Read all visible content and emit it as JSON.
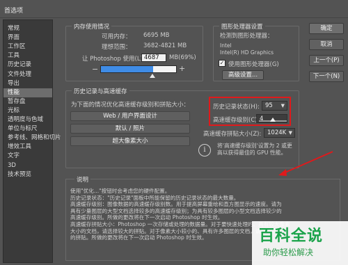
{
  "window": {
    "title": "首选项"
  },
  "sidebar": {
    "items": [
      {
        "label": "常规"
      },
      {
        "label": "界面"
      },
      {
        "label": "工作区"
      },
      {
        "label": "工具"
      },
      {
        "label": "历史记录"
      },
      {
        "label": "文件处理"
      },
      {
        "label": "导出"
      },
      {
        "label": "性能"
      },
      {
        "label": "暂存盘"
      },
      {
        "label": "光标"
      },
      {
        "label": "透明度与色域"
      },
      {
        "label": "单位与标尺"
      },
      {
        "label": "参考线、网格和切片"
      },
      {
        "label": "增效工具"
      },
      {
        "label": "文字"
      },
      {
        "label": "3D"
      },
      {
        "label": "技术预览"
      }
    ],
    "active_index": 7
  },
  "memory": {
    "title": "内存使用情况",
    "available_label": "可用内存：",
    "available_value": "6695 MB",
    "ideal_label": "理想范围：",
    "ideal_value": "3682-4821 MB",
    "let_use_label": "让 Photoshop 使用(L):",
    "let_use_value": "4687",
    "let_use_unit": "MB(69%)",
    "minus": "−",
    "plus": "+",
    "slider_fill_fraction": 0.69
  },
  "gpu": {
    "title": "图形处理器设置",
    "detected_label": "检测到图形处理器：",
    "vendor": "Intel",
    "model": "Intel(R) HD Graphics",
    "use_gpu_label": "使用图形处理器(G)",
    "use_gpu_checked": true,
    "advanced_button": "高级设置..."
  },
  "history_cache": {
    "title": "历史记录与高速缓存",
    "optimize_label": "为下面的情况优化高速缓存级别和拼贴大小：",
    "preset_web": "Web / 用户界面设计",
    "preset_default": "默认 / 照片",
    "preset_huge": "超大像素大小",
    "history_states_label": "历史记录状态(H):",
    "history_states_value": "95",
    "cache_levels_label": "高速缓存级别(C):",
    "cache_levels_value": "4",
    "cache_levels_max": 8,
    "tile_size_label": "高速缓存拼贴大小(Z):",
    "tile_size_value": "1024K",
    "info_icon": "i",
    "info_text_1": "将'高速缓存级别'设置为 2 或更",
    "info_text_2": "高以获得最佳的 GPU 性能。"
  },
  "description": {
    "title": "说明",
    "lines": [
      "使用\"优化...\"按钮时会考虑您的硬件配置。",
      "历史记录状态：\"历史记录\"面板中所能保留的历史记录状态的最大数量。",
      "高速缓存级别：图像数据的高速缓存级别数。用于提高屏幕重绘和直方图显示的速度。请为",
      "具有少量图层的大型文档选择较多的高速缓存级别；为具有较多图层的小型文档选择较少的",
      "高速缓存级别。所做的更改将在下一次启动 Photoshop 时生效。",
      "高速缓存拼贴大小：Photoshop 一次存储或处理的数据量。对于要快速处理的、具有较大像素",
      "大小的文档，请选择较大的拼贴。对于像素大小较小的、具有许多图层的文档，请选择较小",
      "的拼贴。所做的更改将在下一次启动 Photoshop 时生效。"
    ]
  },
  "buttons": {
    "ok": "确定",
    "cancel": "取消",
    "prev": "上一个(P)",
    "next": "下一个(N)"
  },
  "watermark": {
    "title": "百科全说",
    "subtitle": "助你轻松解决"
  },
  "colors": {
    "highlight_red": "#e0191b",
    "slider_blue": "#3f8ce6",
    "watermark_green": "#1aa34a"
  }
}
